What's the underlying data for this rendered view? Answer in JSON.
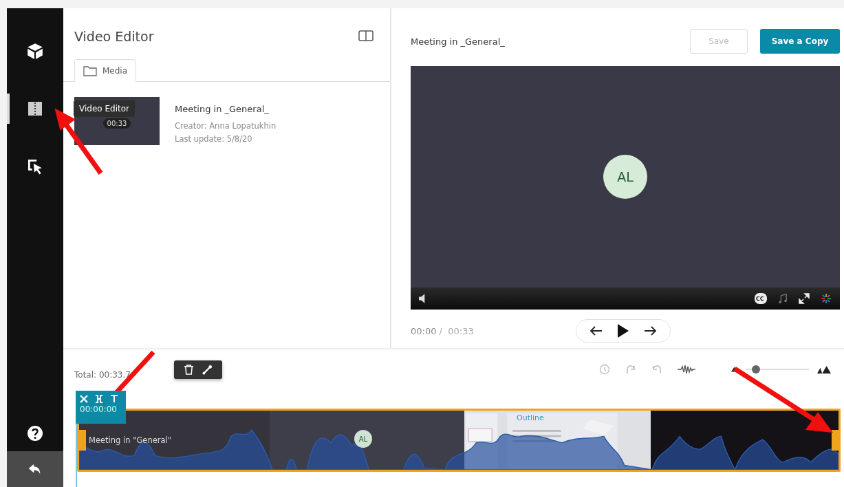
{
  "sidebar": {
    "items": [
      {
        "kind": "cube",
        "selected": false
      },
      {
        "kind": "film",
        "selected": true
      },
      {
        "kind": "cursor",
        "selected": false
      }
    ],
    "tooltip": "Video Editor"
  },
  "library": {
    "title": "Video Editor",
    "tabs": [
      {
        "label": "Media",
        "selected": true
      }
    ],
    "media": [
      {
        "title": "Meeting in _General_",
        "creator": "Creator: Anna Lopatukhin",
        "updated": "Last update: 5/8/20",
        "duration": "00:33"
      }
    ]
  },
  "player": {
    "title": "Meeting in _General_",
    "save": {
      "label": "Save",
      "disabled": true
    },
    "save_copy": {
      "label": "Save a Copy",
      "disabled": false
    },
    "avatar": "AL",
    "current": "00:00",
    "separator": "/",
    "total": "00:33"
  },
  "timeline": {
    "total": "Total: 00:33.7",
    "zoom": {
      "level": 0.1
    },
    "clip": {
      "time": "00:00:00",
      "label": "Meeting in \"General\"",
      "avatar": "AL",
      "slide_title": "Outline"
    }
  }
}
